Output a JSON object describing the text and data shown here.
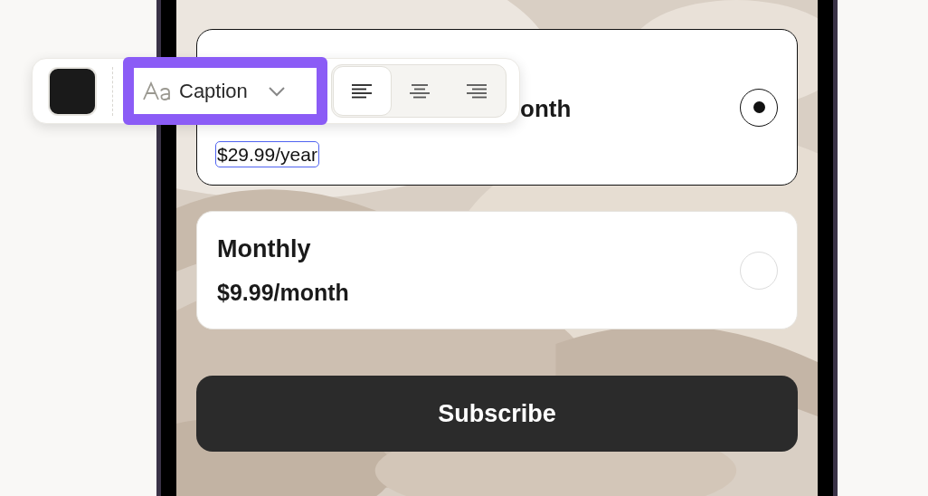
{
  "toolbar": {
    "color_swatch": {
      "color": "#1a1a1a"
    },
    "font_style": {
      "value": "Caption",
      "highlighted": true
    },
    "alignment": [
      {
        "kind": "left",
        "selected": true
      },
      {
        "kind": "center",
        "selected": false
      },
      {
        "kind": "right",
        "selected": false
      }
    ]
  },
  "plans": [
    {
      "visible_text": "onth",
      "price": "$29.99/year",
      "price_in_edit": true,
      "selected": true
    },
    {
      "title": "Monthly",
      "price": "$9.99/month",
      "price_in_edit": false,
      "selected": false
    }
  ],
  "subscribe_button": "Subscribe"
}
